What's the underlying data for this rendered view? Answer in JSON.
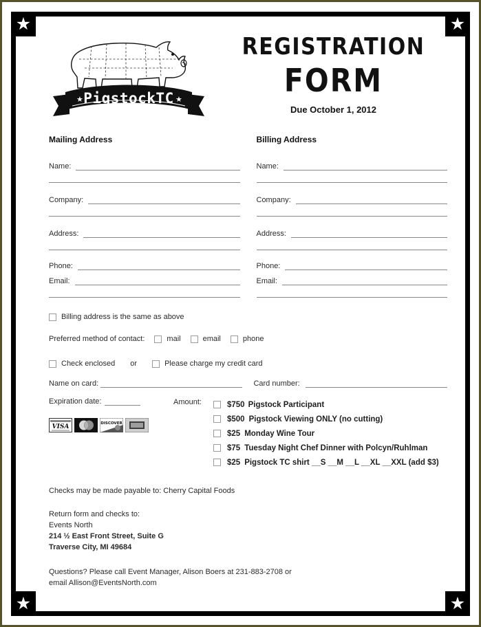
{
  "document": {
    "title_main": "REGISTRATION",
    "title_sub": "FORM",
    "due_text": "Due October 1, 2012",
    "logo_text": "PigstockTC",
    "logo_alt": "pig-butcher-chart-logo"
  },
  "mailing": {
    "heading": "Mailing Address",
    "fields": [
      {
        "label": "Name:",
        "value": ""
      },
      {
        "label": "Company:",
        "value": ""
      },
      {
        "label": "Address:",
        "value": ""
      },
      {
        "label": "Phone:",
        "value": ""
      },
      {
        "label": "Email:",
        "value": ""
      }
    ]
  },
  "billing": {
    "heading": "Billing Address",
    "fields": [
      {
        "label": "Name:",
        "value": ""
      },
      {
        "label": "Company:",
        "value": ""
      },
      {
        "label": "Address:",
        "value": ""
      },
      {
        "label": "Phone:",
        "value": ""
      },
      {
        "label": "Email:",
        "value": ""
      }
    ]
  },
  "billing_same": {
    "label": "Billing address is the same as above",
    "checked": false
  },
  "contact_pref": {
    "label": "Preferred method of contact:",
    "options": [
      {
        "label": "mail",
        "checked": false
      },
      {
        "label": "email",
        "checked": false
      },
      {
        "label": "phone",
        "checked": false
      }
    ]
  },
  "payment": {
    "check_enclosed_label": "Check enclosed",
    "or_label": "or",
    "credit_card_label": "Please charge my credit card",
    "name_on_card_label": "Name on card:",
    "name_on_card_value": "",
    "card_number_label": "Card number:",
    "card_number_value": "",
    "expiration_label": "Expiration date:",
    "expiration_value": "",
    "amount_label": "Amount:",
    "accepted_cards": [
      "visa-logo",
      "mastercard-logo",
      "discover-logo",
      "amex-logo"
    ]
  },
  "amount_options": [
    {
      "price": "$750",
      "desc": "Pigstock Participant",
      "checked": false
    },
    {
      "price": "$500",
      "desc": "Pigstock Viewing ONLY (no cutting)",
      "checked": false
    },
    {
      "price": "$25",
      "desc": "Monday Wine Tour",
      "checked": false
    },
    {
      "price": "$75",
      "desc": "Tuesday Night Chef Dinner with Polcyn/Ruhlman",
      "checked": false
    },
    {
      "price": "$25",
      "desc": "Pigstock TC shirt __S __M __L __XL __XXL (add $3)",
      "checked": false
    }
  ],
  "footer": {
    "checks_payable": "Checks may be made payable to: Cherry Capital Foods",
    "return_heading": "Return form and checks to:",
    "return_org": "Events North",
    "return_street": "214 ½ East Front Street, Suite G",
    "return_city": "Traverse City, MI 49684",
    "questions_line1": "Questions? Please call Event Manager, Alison Boers at 231-883-2708 or",
    "questions_line2": "email Allison@EventsNorth.com"
  },
  "decor": {
    "star_glyph": "★",
    "corner_names": [
      "corner-star-top-left",
      "corner-star-top-right",
      "corner-star-bottom-left",
      "corner-star-bottom-right"
    ]
  },
  "colors": {
    "frame": "#000000",
    "outer_rule": "#56532c",
    "text": "#1a1a1a",
    "rule_line": "#888888"
  }
}
